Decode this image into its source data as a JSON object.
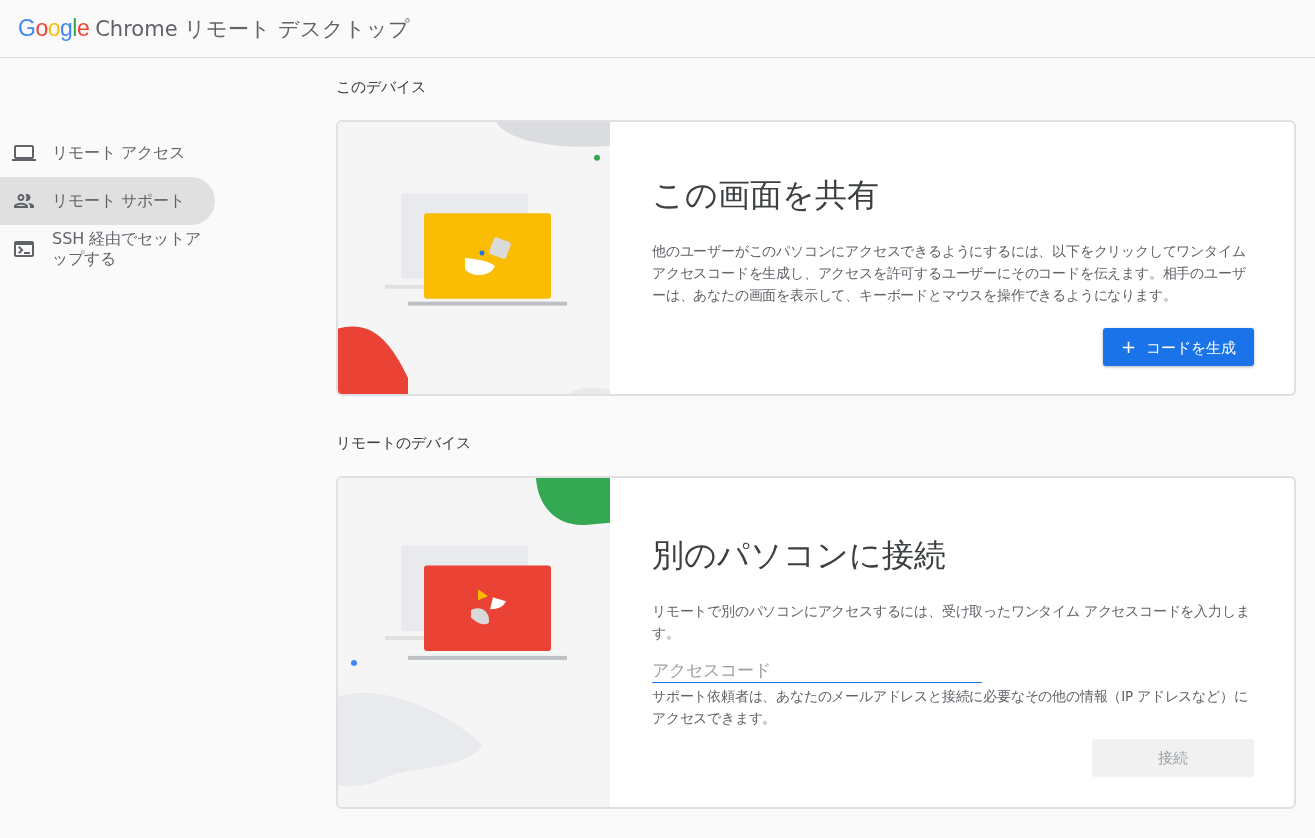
{
  "header": {
    "logo": "Google",
    "title": "Chrome リモート デスクトップ"
  },
  "sidebar": {
    "items": [
      {
        "kind": "laptop",
        "label": "リモート アクセス",
        "selected": false
      },
      {
        "kind": "people",
        "label": "リモート サポート",
        "selected": true
      },
      {
        "kind": "terminal",
        "label": "SSH 経由でセットアップする",
        "selected": false
      }
    ]
  },
  "sections": [
    {
      "heading": "このデバイス",
      "card": {
        "kind": "share",
        "title": "この画面を共有",
        "description": "他のユーザーがこのパソコンにアクセスできるようにするには、以下をクリックしてワンタイムアクセスコードを生成し、アクセスを許可するユーザーにそのコードを伝えます。相手のユーザーは、あなたの画面を表示して、キーボードとマウスを操作できるようになります。",
        "button": {
          "icon": "+",
          "label": "コードを生成",
          "disabled": false
        }
      }
    },
    {
      "heading": "リモートのデバイス",
      "card": {
        "kind": "connect",
        "title": "別のパソコンに接続",
        "description": "リモートで別のパソコンにアクセスするには、受け取ったワンタイム アクセスコードを入力します。",
        "input": {
          "placeholder": "アクセスコード"
        },
        "note": "サポート依頼者は、あなたのメールアドレスと接続に必要なその他の情報（IP アドレスなど）にアクセスできます。",
        "button": {
          "label": "接続",
          "disabled": true
        }
      }
    }
  ]
}
